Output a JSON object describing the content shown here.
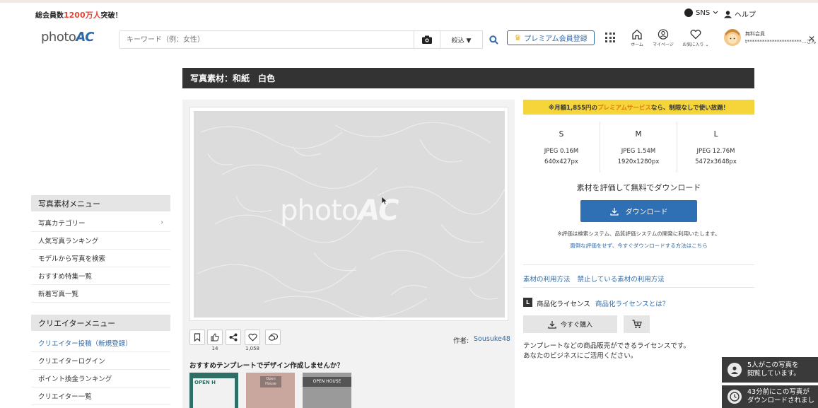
{
  "topbar": {
    "member_prefix": "総会員数",
    "member_count": "1200万人",
    "member_suffix": "突破！",
    "sns_label": "SNS",
    "help_label": "ヘルプ"
  },
  "header": {
    "logo_text": "photo",
    "logo_ac": "AC",
    "search_placeholder": "キーワード（例：女性）",
    "filter_label": "絞込 ▼",
    "premium_label": "プレミアム会員登録",
    "nav": [
      {
        "label": "ホーム",
        "icon": "home-icon"
      },
      {
        "label": "マイページ",
        "icon": "user-circle-icon"
      },
      {
        "label": "お気に入り ⌄",
        "icon": "heart-icon"
      }
    ],
    "user_status": "無料会員",
    "user_email": "t**********************...さん"
  },
  "title": "写真素材：和紙　白色",
  "sidebar": {
    "photo_menu_title": "写真素材メニュー",
    "photo_menu": [
      "写真カテゴリー",
      "人気写真ランキング",
      "モデルから写真を検索",
      "おすすめ特集一覧",
      "新着写真一覧"
    ],
    "creator_menu_title": "クリエイターメニュー",
    "creator_menu": [
      "クリエイター投稿（新規登録）",
      "クリエイターログイン",
      "ポイント換金ランキング",
      "クリエイター一覧"
    ]
  },
  "image": {
    "watermark": "photo",
    "watermark_ac": "AC",
    "like_count": "14",
    "favorite_count": "1,058",
    "author_label": "作者:",
    "author_name": "Sousuke48"
  },
  "recommend": {
    "title": "おすすめテンプレートでデザイン作成しませんか？",
    "thumbs": [
      {
        "label": "OPEN H",
        "bg": "#2e6e64"
      },
      {
        "label": "Open House",
        "bg": "#c9a79f"
      },
      {
        "label": "OPEN HOUSE",
        "bg": "#555555"
      }
    ]
  },
  "right": {
    "promo_prefix": "※月額1,855円の",
    "promo_highlight": "プレミアムサービス",
    "promo_suffix": "なら、制限なしで使い放題！",
    "sizes": [
      {
        "name": "S",
        "format": "JPEG 0.16M",
        "dims": "640x427px"
      },
      {
        "name": "M",
        "format": "JPEG 1.54M",
        "dims": "1920x1280px"
      },
      {
        "name": "L",
        "format": "JPEG 12.76M",
        "dims": "5472x3648px"
      }
    ],
    "dl_text": "素材を評価して無料でダウンロード",
    "dl_button": "ダウンロード",
    "note": "※評価は検索システム、品質評価システムの開発に利用いたします。",
    "note_link": "面倒な評価をせず、今すぐダウンロードする方法はこちら",
    "usage_link_1": "素材の利用方法",
    "usage_link_2": "禁止している素材の利用方法",
    "license_badge": "L",
    "license_label": "商品化ライセンス",
    "license_link": "商品化ライセンスとは？",
    "buy_button": "今すぐ購入",
    "license_desc_1": "テンプレートなどの商品販売ができるライセンスです。",
    "license_desc_2": "あなたのビジネスにご活用ください。"
  },
  "toasts": [
    {
      "line1": "5人がこの写真を",
      "line2": "閲覧しています。"
    },
    {
      "line1": "43分前にこの写真が",
      "line2": "ダウンロードされまし"
    }
  ],
  "colors": {
    "accent": "#2f6fb4",
    "promo": "#f6d53a",
    "titlebar": "#333333",
    "highlight_red": "#e0473a"
  }
}
